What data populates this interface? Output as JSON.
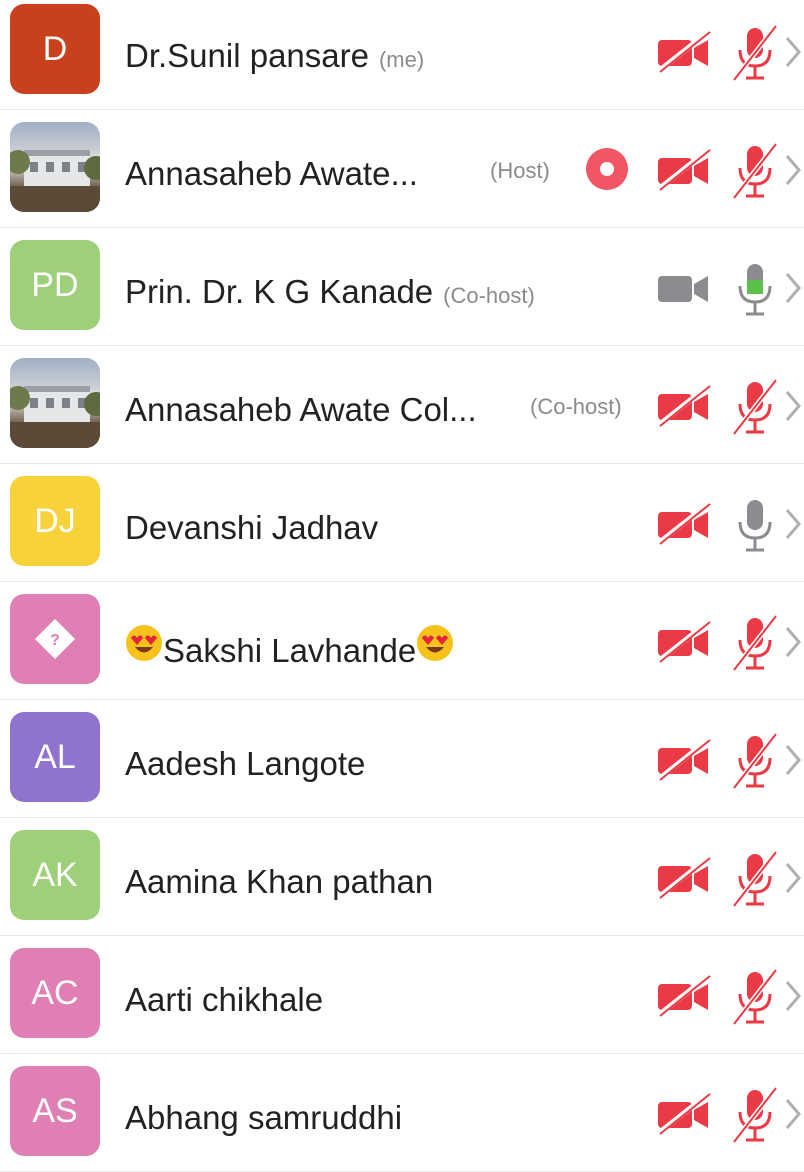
{
  "participants": [
    {
      "name": "Dr.Sunil pansare",
      "role": "(me)",
      "avatar_text": "D",
      "avatar_color": "#c8401c",
      "video": "off",
      "audio": "muted"
    },
    {
      "name": "Annasaheb Awate...",
      "role": "(Host)",
      "avatar_text": "",
      "avatar_type": "photo",
      "sharing": true,
      "video": "off",
      "audio": "muted"
    },
    {
      "name": "Prin. Dr. K G Kanade",
      "role": "(Co-host)",
      "avatar_text": "PD",
      "avatar_color": "#9ed07a",
      "video": "on",
      "audio": "speaking"
    },
    {
      "name": "Annasaheb Awate Col...",
      "role": "(Co-host)",
      "avatar_text": "",
      "avatar_type": "photo",
      "video": "off",
      "audio": "muted"
    },
    {
      "name": "Devanshi Jadhav",
      "role": "",
      "avatar_text": "DJ",
      "avatar_color": "#f8d23a",
      "video": "off",
      "audio": "on"
    },
    {
      "name": "Sakshi Lavhande",
      "role": "",
      "avatar_text": "",
      "avatar_type": "diamond-icon",
      "avatar_color": "#e07fb4",
      "emoji": "heart-eyes-emoji",
      "video": "off",
      "audio": "muted"
    },
    {
      "name": "Aadesh Langote",
      "role": "",
      "avatar_text": "AL",
      "avatar_color": "#9073cf",
      "video": "off",
      "audio": "muted"
    },
    {
      "name": "Aamina Khan pathan",
      "role": "",
      "avatar_text": "AK",
      "avatar_color": "#9ed07a",
      "video": "off",
      "audio": "muted"
    },
    {
      "name": "Aarti chikhale",
      "role": "",
      "avatar_text": "AC",
      "avatar_color": "#e07fb4",
      "video": "off",
      "audio": "muted"
    },
    {
      "name": "Abhang samruddhi",
      "role": "",
      "avatar_text": "AS",
      "avatar_color": "#e07fb4",
      "video": "off",
      "audio": "muted"
    }
  ],
  "colors": {
    "muted_red": "#ea3a45",
    "share_red": "#f25564",
    "speaking_green": "#5bc14b",
    "icon_gray": "#8c8c90",
    "text": "#222222",
    "subtext": "#8a8a8f"
  }
}
